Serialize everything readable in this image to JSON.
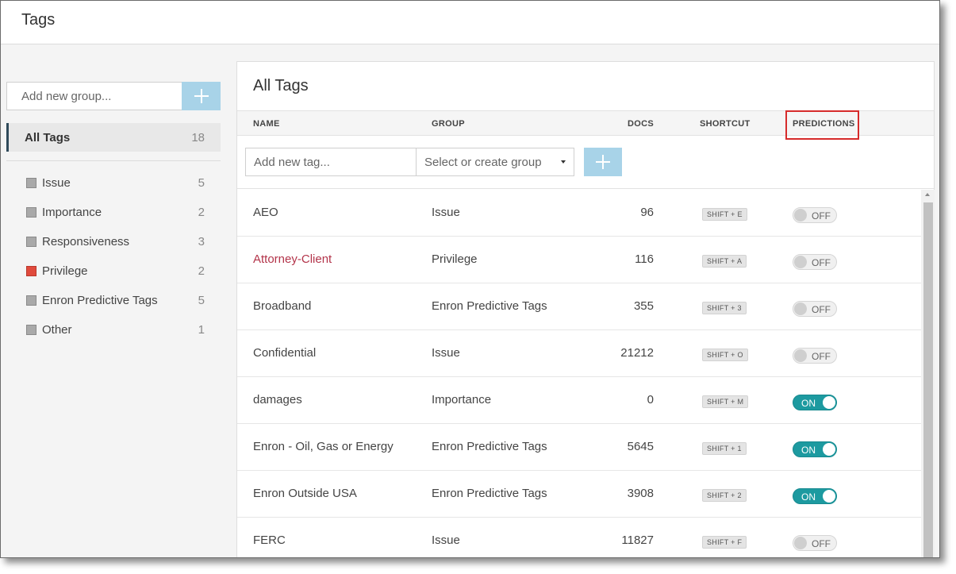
{
  "header": {
    "title": "Tags"
  },
  "sidebar": {
    "add_group_placeholder": "Add new group...",
    "all_tags": {
      "label": "All Tags",
      "count": "18"
    },
    "groups": [
      {
        "name": "Issue",
        "count": "5",
        "color": "#a9a9a9"
      },
      {
        "name": "Importance",
        "count": "2",
        "color": "#a9a9a9"
      },
      {
        "name": "Responsiveness",
        "count": "3",
        "color": "#a9a9a9"
      },
      {
        "name": "Privilege",
        "count": "2",
        "color": "#e04a3c"
      },
      {
        "name": "Enron Predictive Tags",
        "count": "5",
        "color": "#a9a9a9"
      },
      {
        "name": "Other",
        "count": "1",
        "color": "#a9a9a9"
      }
    ]
  },
  "main": {
    "title": "All Tags",
    "columns": {
      "name": "NAME",
      "group": "GROUP",
      "docs": "DOCS",
      "shortcut": "SHORTCUT",
      "predictions": "PREDICTIONS"
    },
    "add_tag_placeholder": "Add new tag...",
    "group_select_placeholder": "Select or create group",
    "rows": [
      {
        "name": "AEO",
        "group": "Issue",
        "docs": "96",
        "shortcut": "SHIFT + E",
        "prediction": "OFF"
      },
      {
        "name": "Attorney-Client",
        "group": "Privilege",
        "docs": "116",
        "shortcut": "SHIFT + A",
        "prediction": "OFF"
      },
      {
        "name": "Broadband",
        "group": "Enron Predictive Tags",
        "docs": "355",
        "shortcut": "SHIFT + 3",
        "prediction": "OFF"
      },
      {
        "name": "Confidential",
        "group": "Issue",
        "docs": "21212",
        "shortcut": "SHIFT + O",
        "prediction": "OFF"
      },
      {
        "name": "damages",
        "group": "Importance",
        "docs": "0",
        "shortcut": "SHIFT + M",
        "prediction": "ON"
      },
      {
        "name": "Enron - Oil, Gas or Energy",
        "group": "Enron Predictive Tags",
        "docs": "5645",
        "shortcut": "SHIFT + 1",
        "prediction": "ON"
      },
      {
        "name": "Enron Outside USA",
        "group": "Enron Predictive Tags",
        "docs": "3908",
        "shortcut": "SHIFT + 2",
        "prediction": "ON"
      },
      {
        "name": "FERC",
        "group": "Issue",
        "docs": "11827",
        "shortcut": "SHIFT + F",
        "prediction": "OFF"
      }
    ]
  },
  "colors": {
    "accent": "#1d9aa0",
    "add_button": "#a8d3e8",
    "highlight_box": "#d62b2b",
    "privilege_text": "#b3344a"
  }
}
